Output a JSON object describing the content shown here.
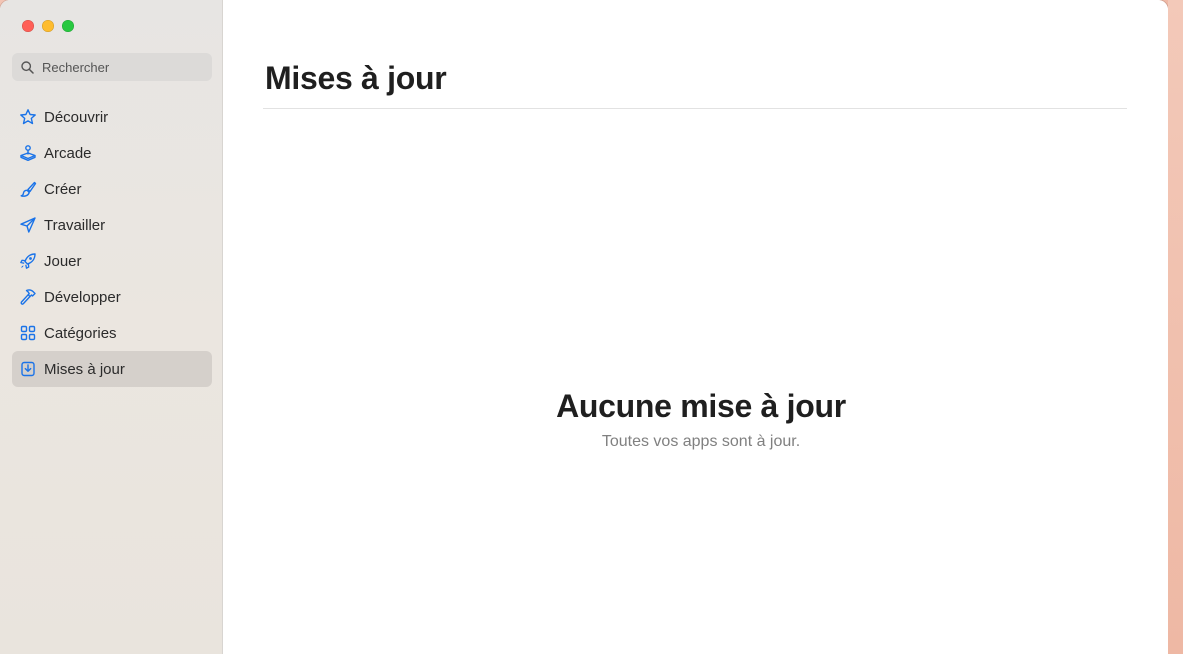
{
  "window": {
    "traffic_lights": [
      {
        "name": "close-button",
        "color": "#ff5f57"
      },
      {
        "name": "minimize-button",
        "color": "#febc2e"
      },
      {
        "name": "zoom-button",
        "color": "#28c840"
      }
    ]
  },
  "sidebar": {
    "search": {
      "placeholder": "Rechercher",
      "icon": "search-icon"
    },
    "items": [
      {
        "label": "Découvrir",
        "icon": "star-icon",
        "selected": false
      },
      {
        "label": "Arcade",
        "icon": "joystick-icon",
        "selected": false
      },
      {
        "label": "Créer",
        "icon": "paintbrush-icon",
        "selected": false
      },
      {
        "label": "Travailler",
        "icon": "paperplane-icon",
        "selected": false
      },
      {
        "label": "Jouer",
        "icon": "rocket-icon",
        "selected": false
      },
      {
        "label": "Développer",
        "icon": "hammer-icon",
        "selected": false
      },
      {
        "label": "Catégories",
        "icon": "grid-icon",
        "selected": false
      },
      {
        "label": "Mises à jour",
        "icon": "download-icon",
        "selected": true
      }
    ]
  },
  "main": {
    "title": "Mises à jour",
    "empty_state": {
      "title": "Aucune mise à jour",
      "subtitle": "Toutes vos apps sont à jour."
    }
  },
  "colors": {
    "accent": "#1a73e8",
    "sidebar_selected": "#d5d0cb"
  }
}
